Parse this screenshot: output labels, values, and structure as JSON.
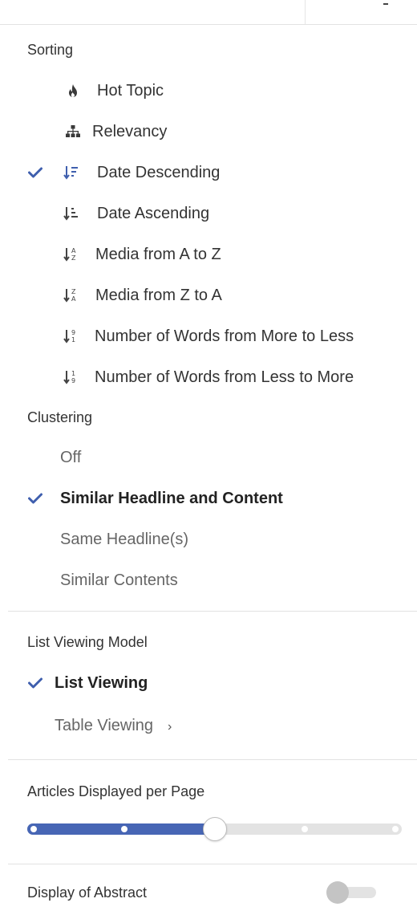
{
  "sorting": {
    "title": "Sorting",
    "items": [
      {
        "label": "Hot Topic",
        "icon": "flame-icon",
        "checked": false
      },
      {
        "label": "Relevancy",
        "icon": "hierarchy-icon",
        "checked": false
      },
      {
        "label": "Date Descending",
        "icon": "sort-date-descending-icon",
        "checked": true
      },
      {
        "label": "Date Ascending",
        "icon": "sort-date-ascending-icon",
        "checked": false
      },
      {
        "label": "Media from A to Z",
        "icon": "sort-alpha-asc-icon",
        "checked": false
      },
      {
        "label": "Media from Z to A",
        "icon": "sort-alpha-desc-icon",
        "checked": false
      },
      {
        "label": "Number of Words from More to Less",
        "icon": "sort-numeric-desc-icon",
        "checked": false
      },
      {
        "label": "Number of Words from Less to More",
        "icon": "sort-numeric-asc-icon",
        "checked": false
      }
    ]
  },
  "clustering": {
    "title": "Clustering",
    "items": [
      {
        "label": "Off",
        "checked": false
      },
      {
        "label": "Similar Headline and Content",
        "checked": true
      },
      {
        "label": "Same Headline(s)",
        "checked": false
      },
      {
        "label": "Similar Contents",
        "checked": false
      }
    ]
  },
  "list_viewing_model": {
    "title": "List Viewing Model",
    "items": [
      {
        "label": "List Viewing",
        "checked": true
      },
      {
        "label": "Table Viewing",
        "checked": false,
        "has_submenu": true
      }
    ]
  },
  "articles_per_page": {
    "title": "Articles Displayed per Page",
    "slider_steps": 5,
    "slider_selected_step": 3
  },
  "display_of_abstract": {
    "title": "Display of Abstract",
    "enabled": false
  },
  "colors": {
    "accent": "#4766b5",
    "check": "#3f5fae"
  }
}
